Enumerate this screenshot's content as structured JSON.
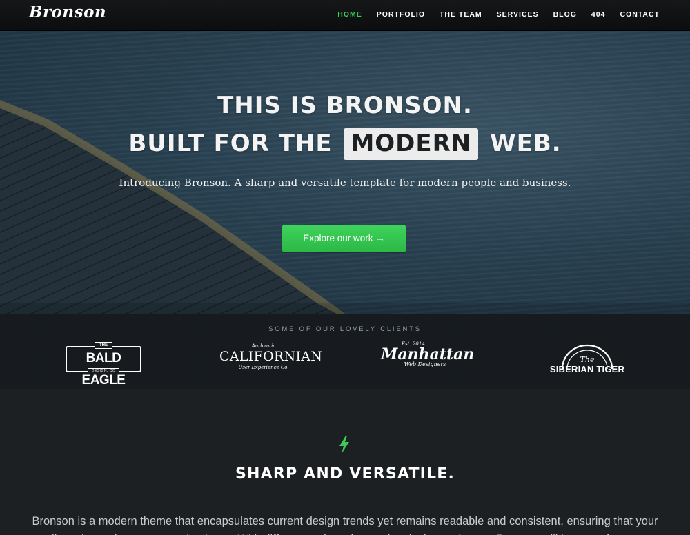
{
  "nav": {
    "logo": "Bronson",
    "items": [
      {
        "label": "HOME",
        "active": true
      },
      {
        "label": "PORTFOLIO",
        "active": false
      },
      {
        "label": "THE TEAM",
        "active": false
      },
      {
        "label": "SERVICES",
        "active": false
      },
      {
        "label": "BLOG",
        "active": false
      },
      {
        "label": "404",
        "active": false
      },
      {
        "label": "CONTACT",
        "active": false
      }
    ]
  },
  "hero": {
    "line1": "THIS IS BRONSON.",
    "line2_before": "BUILT FOR THE",
    "line2_highlight": "MODERN",
    "line2_after": "WEB.",
    "subtitle": "Introducing Bronson. A sharp and versatile template for modern people and business.",
    "cta_label": "Explore our work →"
  },
  "clients": {
    "label": "SOME OF OUR LOVELY CLIENTS",
    "logos": {
      "bald_eagle": {
        "tag": "THE",
        "name": "BALD EAGLE",
        "sub": "DESIGN, CO"
      },
      "californian": {
        "top": "Authentic",
        "name": "CALIFORNIAN",
        "sub": "User Experience Co."
      },
      "manhattan": {
        "top": "Est. 2014",
        "name": "Manhattan",
        "sub": "Web Designers"
      },
      "siberian_tiger": {
        "the": "The",
        "name": "SIBERIAN TIGER"
      }
    }
  },
  "feature": {
    "icon": "lightning-bolt-icon",
    "title": "SHARP AND VERSATILE.",
    "text": "Bronson is a modern theme that encapsulates current design trends yet remains readable and consistent, ensuring that your clients know that you mean business. With different options, innovative design and more, Bronson will be great for you."
  },
  "colors": {
    "accent": "#3ccb57",
    "nav_bg": "#0f1113",
    "dark_bg": "#1d2023"
  }
}
